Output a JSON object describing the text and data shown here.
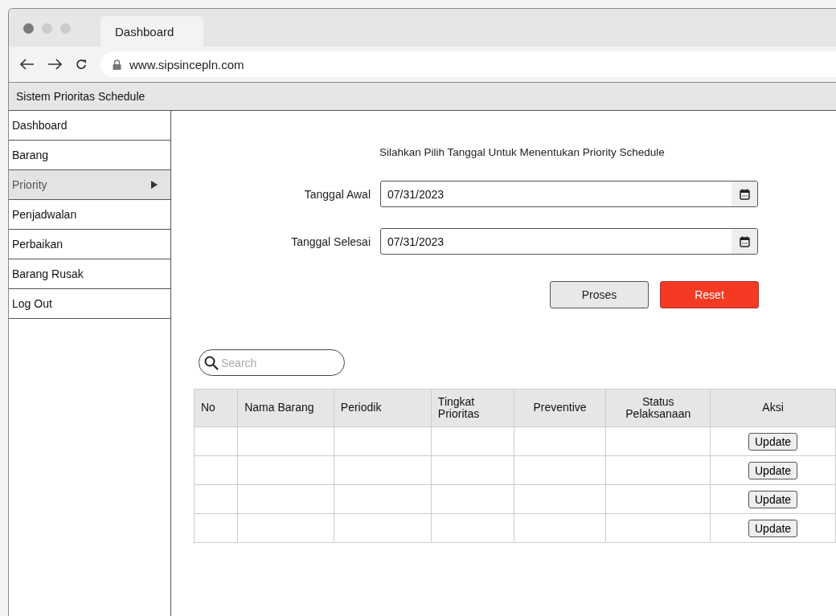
{
  "browser": {
    "tab_title": "Dashboard",
    "url": "www.sipsincepln.com"
  },
  "app": {
    "title": "Sistem Prioritas Schedule"
  },
  "sidebar": {
    "items": [
      {
        "label": "Dashboard",
        "selected": false
      },
      {
        "label": "Barang",
        "selected": false
      },
      {
        "label": "Priority",
        "selected": true
      },
      {
        "label": "Penjadwalan",
        "selected": false
      },
      {
        "label": "Perbaikan",
        "selected": false
      },
      {
        "label": "Barang Rusak",
        "selected": false
      },
      {
        "label": "Log Out",
        "selected": false
      }
    ]
  },
  "form": {
    "heading": "Silahkan Pilih Tanggal Untuk Menentukan Priority Schedule",
    "fields": [
      {
        "label": "Tanggal Awal",
        "value": "07/31/2023"
      },
      {
        "label": "Tanggal Selesai",
        "value": "07/31/2023"
      }
    ],
    "buttons": [
      {
        "label": "Proses",
        "kind": "default"
      },
      {
        "label": "Reset",
        "kind": "danger"
      }
    ]
  },
  "search": {
    "placeholder": "Search"
  },
  "table": {
    "columns": [
      "No",
      "Nama Barang",
      "Periodik",
      "Tingkat Prioritas",
      "Preventive",
      "Status Pelaksanaan",
      "Aksi"
    ],
    "rows": [
      {
        "action": "Update"
      },
      {
        "action": "Update"
      },
      {
        "action": "Update"
      },
      {
        "action": "Update"
      }
    ]
  }
}
